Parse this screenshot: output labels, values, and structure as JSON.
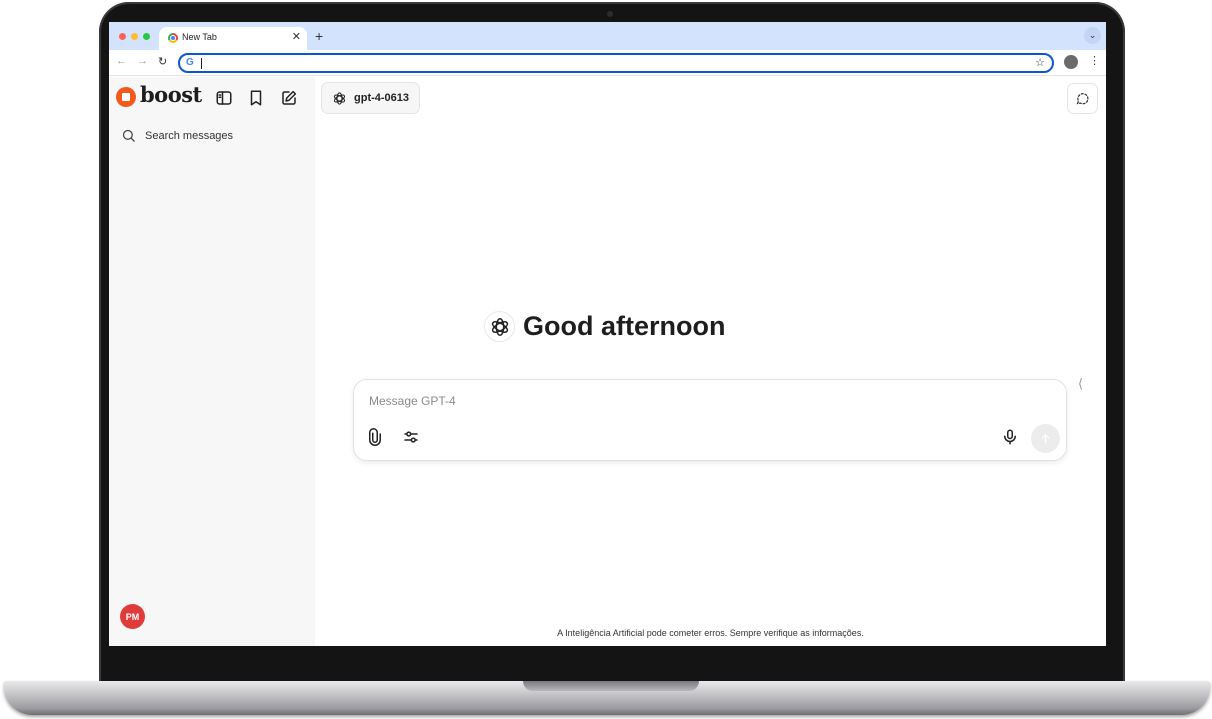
{
  "browser": {
    "tab_title": "New Tab",
    "tab_close": "✕",
    "new_tab": "+",
    "address_value": "",
    "colors": {
      "tabbar": "#d3e3fd",
      "omnibox_border": "#0b57d0"
    }
  },
  "app": {
    "brand": "boost",
    "brand_color": "#f25a1c",
    "search_label": "Search messages",
    "model_label": "gpt-4-0613",
    "greeting": "Good afternoon",
    "composer_placeholder": "Message GPT-4",
    "disclaimer": "A Inteligência Artificial pode cometer erros. Sempre verifique as informações.",
    "avatar_initials": "PM",
    "avatar_color": "#e03b3b",
    "icons": [
      "sidebar-toggle-icon",
      "bookmark-icon",
      "new-chat-icon",
      "search-icon",
      "openai-icon",
      "dashed-chat-icon",
      "paperclip-icon",
      "settings-sliders-icon",
      "microphone-icon",
      "arrow-up-icon"
    ]
  }
}
